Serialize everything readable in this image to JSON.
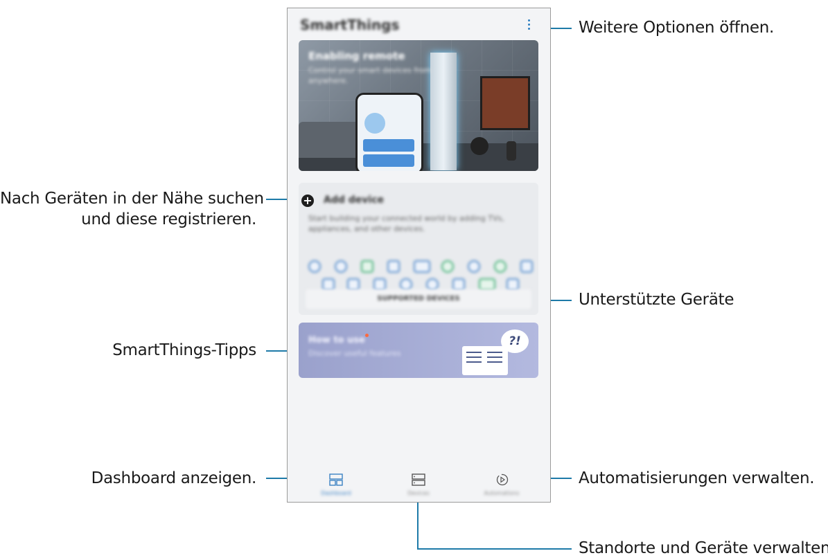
{
  "callouts": {
    "more_options": "Weitere Optionen öffnen.",
    "add_device_line1": "Nach Geräten in der Nähe suchen",
    "add_device_line2": "und diese registrieren.",
    "supported_devices": "Unterstützte Geräte",
    "tips": "SmartThings-Tipps",
    "dashboard": "Dashboard anzeigen.",
    "automations": "Automatisierungen verwalten.",
    "devices": "Standorte und Geräte verwalten."
  },
  "app": {
    "title": "SmartThings",
    "hero": {
      "headline": "Enabling remote",
      "subtitle": "Control your smart devices from anywhere."
    },
    "add_device": {
      "title": "Add device",
      "description": "Start building your connected world by adding TVs, appliances, and other devices."
    },
    "supported_button": "SUPPORTED DEVICES",
    "tips": {
      "title": "How to use",
      "subtitle": "Discover useful features",
      "bubble": "?!"
    },
    "tabs": [
      {
        "label": "Dashboard",
        "icon": "dashboard-icon"
      },
      {
        "label": "Devices",
        "icon": "devices-icon"
      },
      {
        "label": "Automations",
        "icon": "automations-icon"
      }
    ]
  },
  "colors": {
    "callout_line": "#1d7aa8",
    "active_tab": "#3b82c4"
  }
}
